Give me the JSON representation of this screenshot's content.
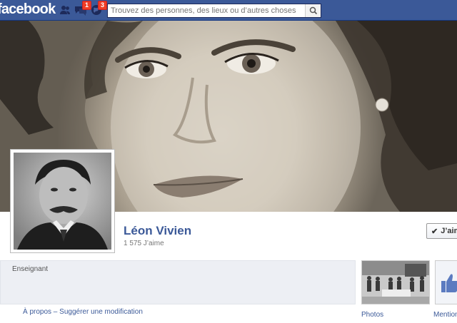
{
  "header": {
    "logo": "facebook",
    "search_placeholder": "Trouvez des personnes, des lieux ou d’autres choses",
    "friend_requests_badge": "",
    "messages_badge": "1",
    "notifications_badge": "3"
  },
  "page": {
    "name": "Léon Vivien",
    "likes": "1 575 J’aime",
    "like_button": "J’aime",
    "category": "Enseignant",
    "about_link": "À propos",
    "separator": " – ",
    "suggest_link": "Suggérer une modification"
  },
  "tiles": {
    "photos_label": "Photos",
    "mentions_label": "Mention"
  },
  "colors": {
    "brand": "#3b5998",
    "badge": "#f03d25"
  },
  "icons": [
    "friends-icon",
    "messages-icon",
    "notifications-icon",
    "search-icon",
    "check-icon",
    "thumbs-up-icon"
  ]
}
